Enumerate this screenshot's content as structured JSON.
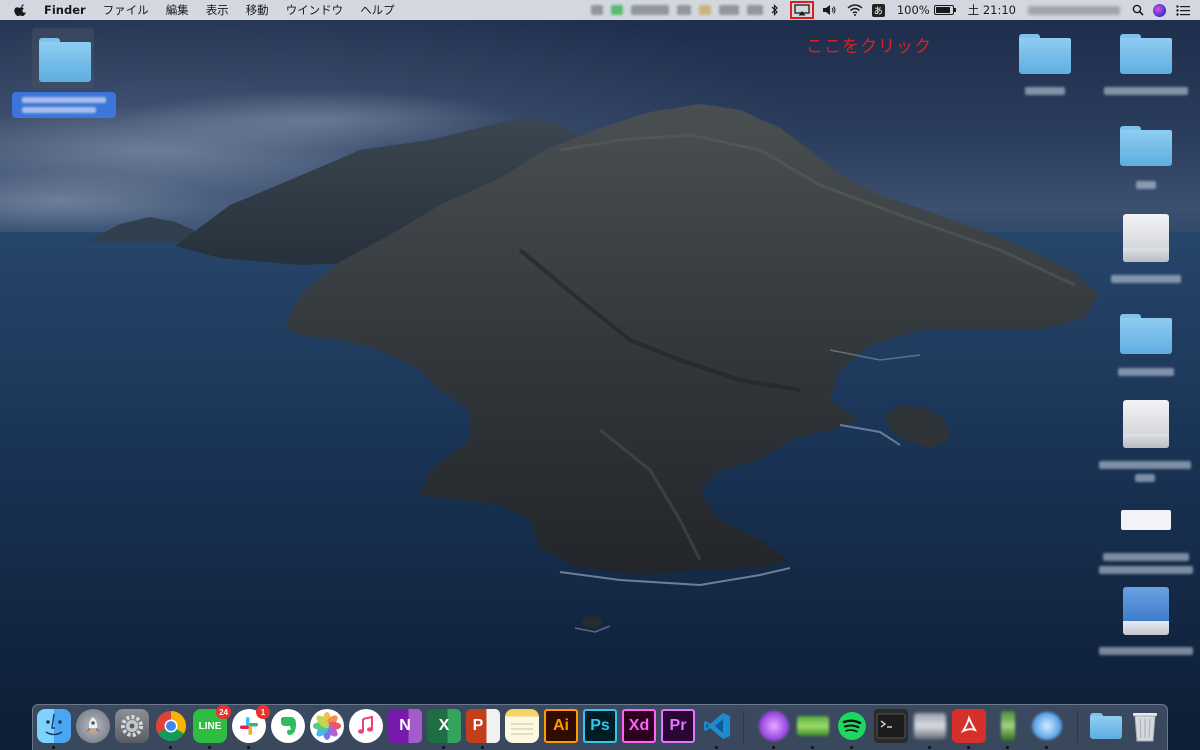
{
  "menubar": {
    "apple": "apple-icon",
    "app_name": "Finder",
    "menus": [
      "ファイル",
      "編集",
      "表示",
      "移動",
      "ウインドウ",
      "ヘルプ"
    ],
    "ime": "あ",
    "battery": "100%",
    "clock": "土 21:10"
  },
  "annotation": {
    "text": "ここをクリック",
    "color": "#e02020"
  },
  "dock": {
    "apps": [
      {
        "name": "finder",
        "icon": "finder-icon"
      },
      {
        "name": "launchpad",
        "icon": "rocket-icon"
      },
      {
        "name": "system-preferences",
        "icon": "gear-icon"
      },
      {
        "name": "chrome",
        "icon": "chrome-icon"
      },
      {
        "name": "line",
        "icon": "line-icon",
        "label": "LINE",
        "badge": "24"
      },
      {
        "name": "slack",
        "icon": "slack-icon",
        "badge": "1"
      },
      {
        "name": "evernote",
        "icon": "evernote-icon"
      },
      {
        "name": "photos",
        "icon": "photos-icon"
      },
      {
        "name": "music",
        "icon": "music-note-icon"
      },
      {
        "name": "onenote",
        "icon": "onenote-icon",
        "label": "N"
      },
      {
        "name": "excel",
        "icon": "excel-icon",
        "label": "X"
      },
      {
        "name": "powerpoint",
        "icon": "powerpoint-icon",
        "label": "P"
      },
      {
        "name": "notes",
        "icon": "notes-icon"
      },
      {
        "name": "illustrator",
        "icon": "illustrator-icon",
        "label": "Ai"
      },
      {
        "name": "photoshop",
        "icon": "photoshop-icon",
        "label": "Ps"
      },
      {
        "name": "xd",
        "icon": "xd-icon",
        "label": "Xd"
      },
      {
        "name": "premiere",
        "icon": "premiere-icon",
        "label": "Pr"
      },
      {
        "name": "vscode",
        "icon": "vscode-icon"
      },
      {
        "name": "blurred-app-1",
        "icon": "blurred-icon"
      },
      {
        "name": "blurred-app-2",
        "icon": "blurred-icon"
      },
      {
        "name": "spotify",
        "icon": "spotify-icon"
      },
      {
        "name": "terminal",
        "icon": "terminal-icon"
      },
      {
        "name": "blurred-app-3",
        "icon": "blurred-icon"
      },
      {
        "name": "acrobat",
        "icon": "acrobat-icon"
      },
      {
        "name": "blurred-app-4",
        "icon": "blurred-icon"
      },
      {
        "name": "blurred-app-5",
        "icon": "blurred-icon"
      },
      {
        "name": "downloads-stack",
        "icon": "folder-icon"
      },
      {
        "name": "trash",
        "icon": "trash-icon"
      }
    ]
  }
}
